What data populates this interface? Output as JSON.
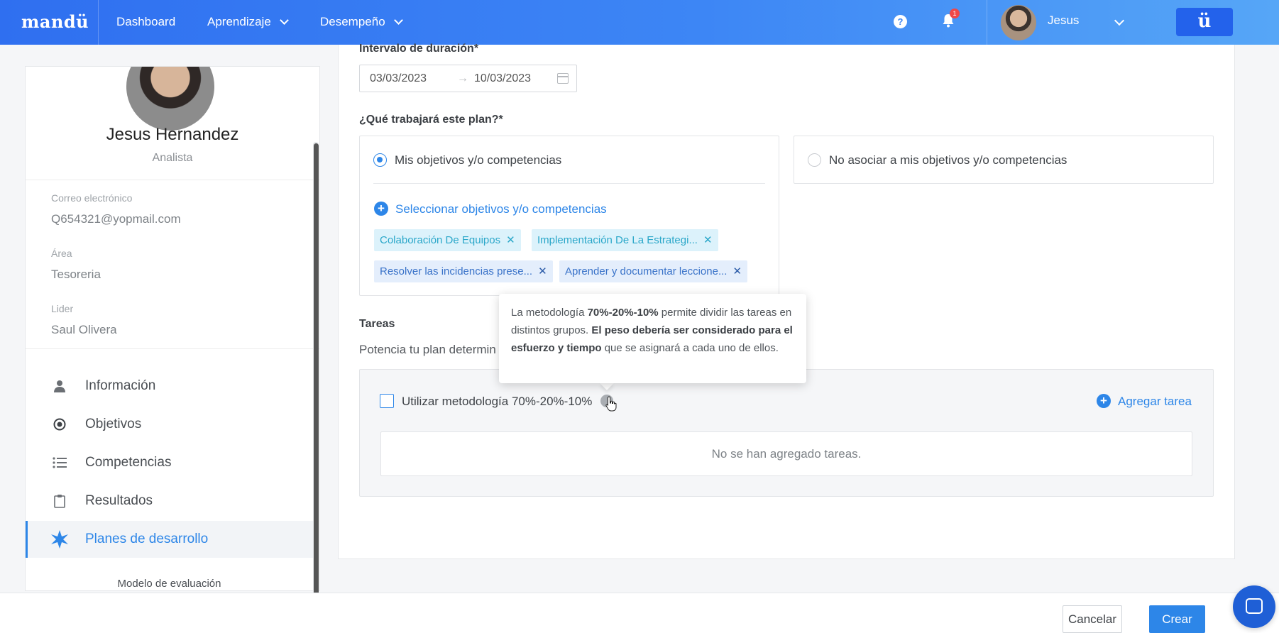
{
  "header": {
    "logo": "mandü",
    "nav": [
      {
        "label": "Dashboard"
      },
      {
        "label": "Aprendizaje"
      },
      {
        "label": "Desempeño"
      }
    ],
    "notification_count": "1",
    "user_name": "Jesus",
    "brand_button": "ü"
  },
  "profile": {
    "name": "Jesus Hernandez",
    "role": "Analista",
    "fields": [
      {
        "label": "Correo electrónico",
        "value": "Q654321@yopmail.com"
      },
      {
        "label": "Área",
        "value": "Tesoreria"
      },
      {
        "label": "Lider",
        "value": "Saul Olivera"
      }
    ],
    "menu": [
      {
        "label": "Información",
        "icon": "person-icon"
      },
      {
        "label": "Objetivos",
        "icon": "target-icon"
      },
      {
        "label": "Competencias",
        "icon": "list-icon"
      },
      {
        "label": "Resultados",
        "icon": "clipboard-icon"
      },
      {
        "label": "Planes de desarrollo",
        "icon": "star-burst-icon",
        "active": true
      }
    ],
    "model_evaluation": "Modelo de evaluación"
  },
  "form": {
    "duration_label": "Intervalo de duración*",
    "date_start": "03/03/2023",
    "date_arrow": "→",
    "date_end": "10/03/2023",
    "work_label": "¿Qué trabajará este plan?*",
    "option_mine": "Mis objetivos y/o competencias",
    "option_none": "No asociar a mis objetivos y/o competencias",
    "select_link": "Seleccionar objetivos y/o competencias",
    "tags": [
      "Colaboración De Equipos",
      "Implementación De La Estrategi...",
      "Resolver las incidencias prese...",
      "Aprender y documentar leccione..."
    ],
    "tasks_label": "Tareas",
    "tasks_subtitle": "Potencia tu plan determin",
    "methodology_label": "Utilizar metodología 70%-20%-10%",
    "add_task": "Agregar tarea",
    "empty_tasks": "No se han agregado tareas."
  },
  "tooltip": {
    "p1": "La metodología ",
    "b1": "70%-20%-10%",
    "p2": " permite dividir las tareas en distintos grupos. ",
    "b2": "El peso debería ser considerado para el esfuerzo y tiempo",
    "p3": " que se asignará a cada uno de ellos."
  },
  "footer": {
    "cancel": "Cancelar",
    "create": "Crear"
  },
  "colors": {
    "primary": "#2d86e8",
    "header_gradient_start": "#2f6ff0",
    "header_gradient_end": "#56a6f7",
    "tag_bg": "#dcf2fb",
    "tag_text": "#2aa7c9"
  }
}
